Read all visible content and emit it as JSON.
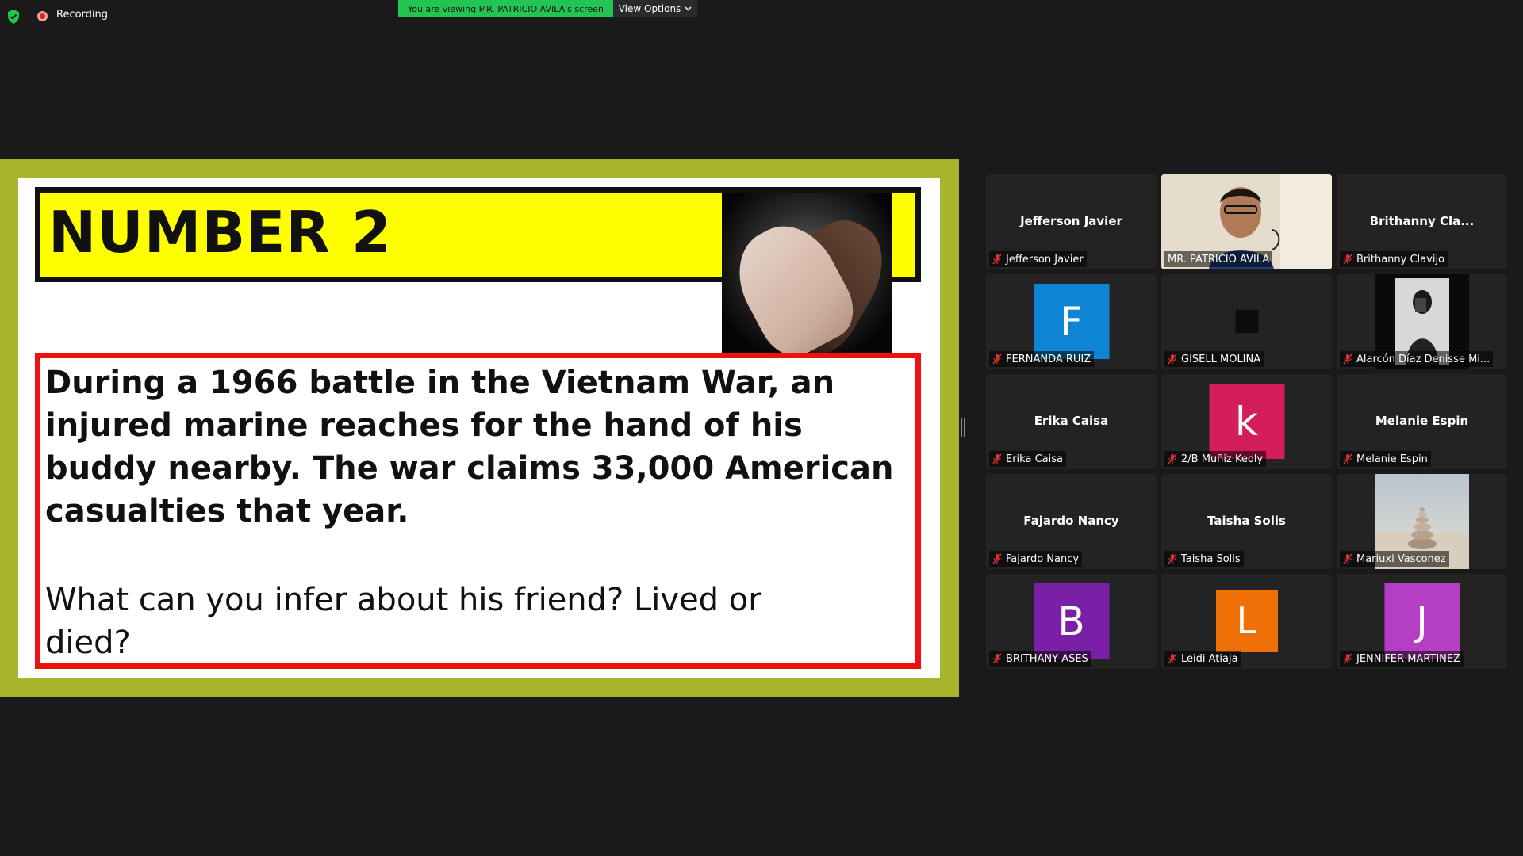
{
  "topbar": {
    "recording_label": "Recording",
    "viewing_banner": "You are viewing MR. PATRICIO AVILA's screen",
    "view_options_label": "View Options"
  },
  "slide": {
    "title": "NUMBER 2",
    "question_main": "During a 1966 battle in the Vietnam War, an injured marine reaches for the hand of his buddy nearby.  The war claims 33,000 American casualties that year.",
    "question_sub": "What can you infer about his friend?  Lived or died?"
  },
  "participants": [
    {
      "name": "Jefferson Javier",
      "center_name": "Jefferson Javier",
      "type": "name"
    },
    {
      "name": "MR. PATRICIO AVILA",
      "type": "video",
      "active": true
    },
    {
      "name": "Brithanny Clavijo",
      "center_name": "Brithanny Cla...",
      "type": "name"
    },
    {
      "name": "FERNANDA RUIZ",
      "type": "letter",
      "letter": "F",
      "color": "#0e85d4"
    },
    {
      "name": "GISELL MOLINA",
      "type": "square"
    },
    {
      "name": "Alarcón Díaz Denisse Mi...",
      "type": "photo-dark"
    },
    {
      "name": "Erika Caisa",
      "center_name": "Erika Caisa",
      "type": "name"
    },
    {
      "name": "2/B Muñiz Keoly",
      "type": "letter",
      "letter": "k",
      "color": "#d41d5b"
    },
    {
      "name": "Melanie Espin",
      "center_name": "Melanie Espin",
      "type": "name"
    },
    {
      "name": "Fajardo Nancy",
      "center_name": "Fajardo Nancy",
      "type": "name"
    },
    {
      "name": "Taisha Solis",
      "center_name": "Taisha Solis",
      "type": "name"
    },
    {
      "name": "Mariuxi Vasconez",
      "type": "photo-stones"
    },
    {
      "name": "BRITHANY ASES",
      "type": "letter",
      "letter": "B",
      "color": "#7a1fa8"
    },
    {
      "name": "Leidi Atiaja",
      "type": "letter",
      "letter": "L",
      "color": "#f07008"
    },
    {
      "name": "JENNIFER MARTINEZ",
      "type": "letter",
      "letter": "J",
      "color": "#b43fc4"
    }
  ],
  "colors": {
    "accent_green": "#23c552",
    "share_border": "#a8b52d",
    "title_yellow": "#ffff00",
    "question_red": "#ee1111"
  }
}
